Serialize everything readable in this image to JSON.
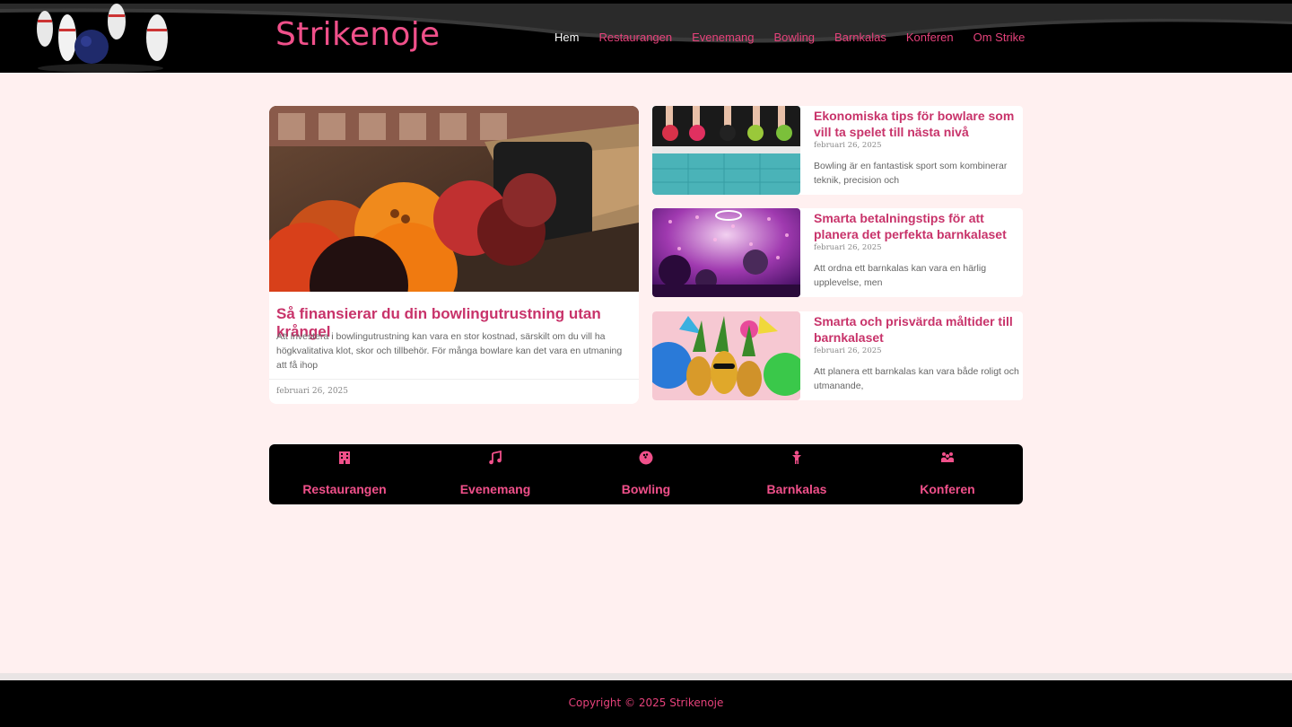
{
  "site": {
    "title": "Strikenoje"
  },
  "nav": {
    "items": [
      {
        "label": "Hem"
      },
      {
        "label": "Restaurangen"
      },
      {
        "label": "Evenemang"
      },
      {
        "label": "Bowling"
      },
      {
        "label": "Barnkalas"
      },
      {
        "label": "Konferen"
      },
      {
        "label": "Om Strike"
      }
    ]
  },
  "featured": {
    "title": "Så finansierar du din bowlingutrustning utan krångel",
    "excerpt": "Att investera i bowlingutrustning kan vara en stor kostnad, särskilt om du vill ha högkvalitativa klot, skor och tillbehör. För många bowlare kan det vara en utmaning att få ihop",
    "date": "februari 26, 2025"
  },
  "posts": [
    {
      "title": "Ekonomiska tips för bowlare som vill ta spelet till nästa nivå",
      "date": "februari 26, 2025",
      "excerpt": "Bowling är en fantastisk sport som kombinerar teknik, precision och"
    },
    {
      "title": "Smarta betalningstips för att planera det perfekta barnkalaset",
      "date": "februari 26, 2025",
      "excerpt": "Att ordna ett barnkalas kan vara en härlig upplevelse, men"
    },
    {
      "title": "Smarta och prisvärda måltider till barnkalaset",
      "date": "februari 26, 2025",
      "excerpt": "Att planera ett barnkalas kan vara både roligt och utmanande,"
    }
  ],
  "bottom_nav": {
    "items": [
      {
        "label": "Restaurangen",
        "icon": "building-icon"
      },
      {
        "label": "Evenemang",
        "icon": "music-icon"
      },
      {
        "label": "Bowling",
        "icon": "bowling-ball-icon"
      },
      {
        "label": "Barnkalas",
        "icon": "child-icon"
      },
      {
        "label": "Konferen",
        "icon": "people-icon"
      }
    ]
  },
  "footer": {
    "copyright": "Copyright © 2025 Strikenoje"
  },
  "colors": {
    "accent": "#f0508a",
    "link": "#e6427b",
    "title": "#c8336a",
    "background": "#fff0f0",
    "header": "#000000"
  }
}
